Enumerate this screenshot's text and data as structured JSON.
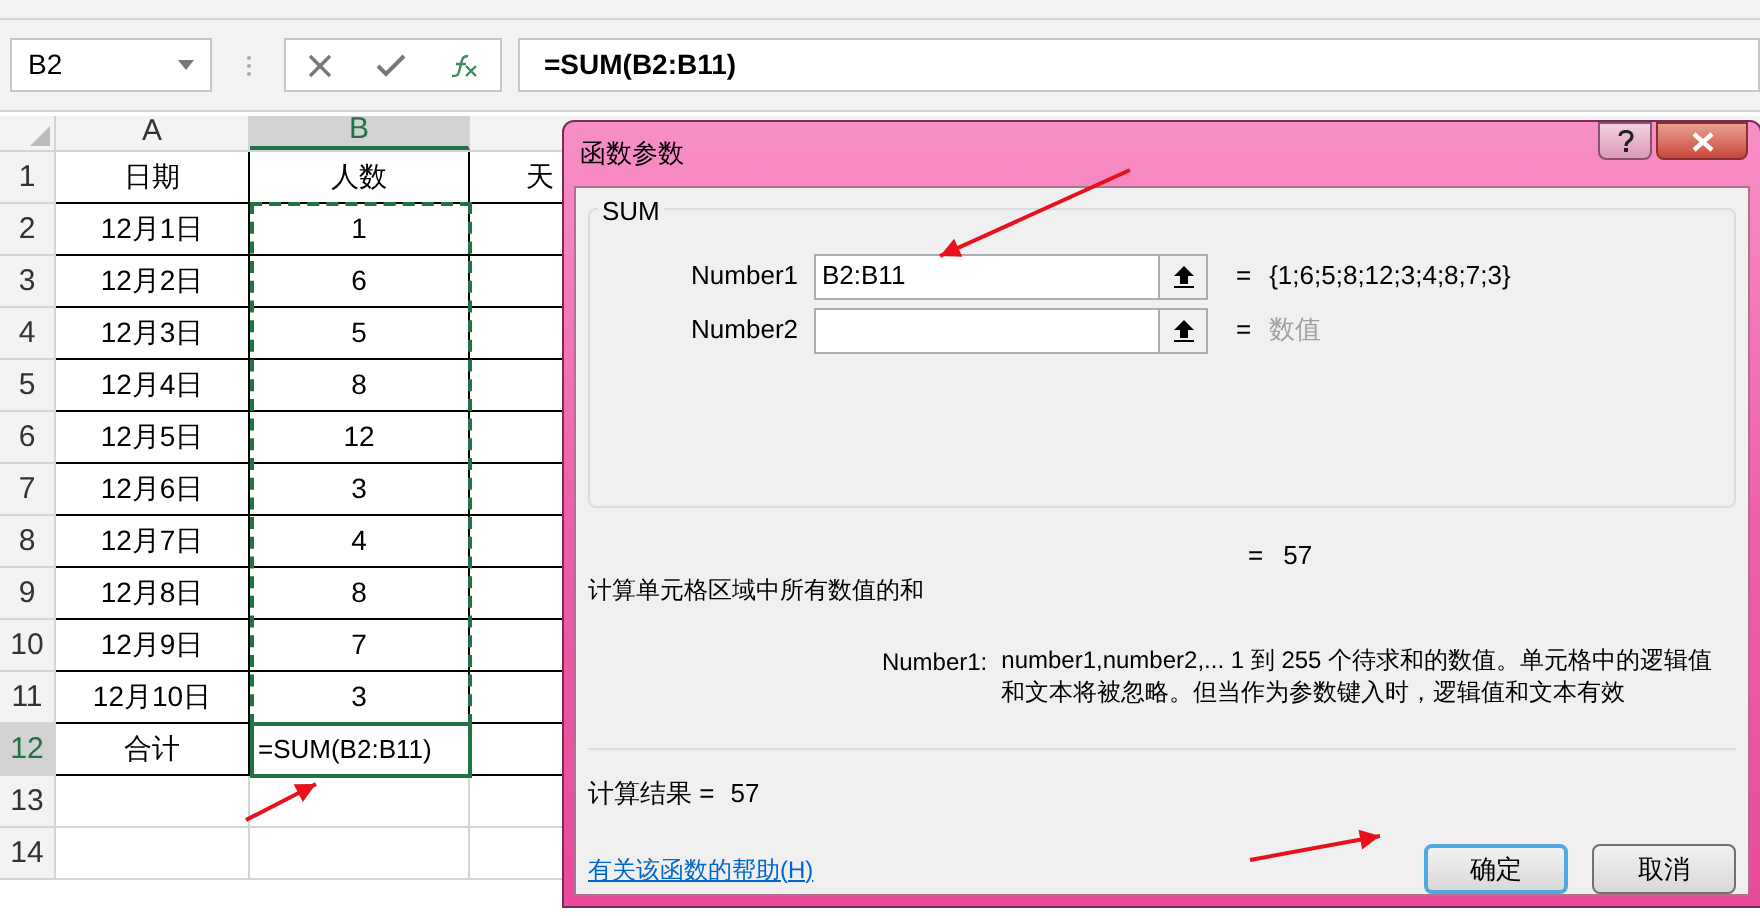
{
  "name_box": {
    "value": "B2"
  },
  "formula_bar": {
    "value": "=SUM(B2:B11)"
  },
  "columns": [
    {
      "label": "A",
      "selected": false
    },
    {
      "label": "B",
      "selected": true
    }
  ],
  "rows": [
    {
      "number": "1",
      "selected": false,
      "cells": [
        "日期",
        "人数",
        "天"
      ]
    },
    {
      "number": "2",
      "selected": false,
      "cells": [
        "12月1日",
        "1"
      ]
    },
    {
      "number": "3",
      "selected": false,
      "cells": [
        "12月2日",
        "6"
      ]
    },
    {
      "number": "4",
      "selected": false,
      "cells": [
        "12月3日",
        "5"
      ]
    },
    {
      "number": "5",
      "selected": false,
      "cells": [
        "12月4日",
        "8"
      ]
    },
    {
      "number": "6",
      "selected": false,
      "cells": [
        "12月5日",
        "12"
      ]
    },
    {
      "number": "7",
      "selected": false,
      "cells": [
        "12月6日",
        "3"
      ]
    },
    {
      "number": "8",
      "selected": false,
      "cells": [
        "12月7日",
        "4"
      ]
    },
    {
      "number": "9",
      "selected": false,
      "cells": [
        "12月8日",
        "8"
      ]
    },
    {
      "number": "10",
      "selected": false,
      "cells": [
        "12月9日",
        "7"
      ]
    },
    {
      "number": "11",
      "selected": false,
      "cells": [
        "12月10日",
        "3"
      ]
    },
    {
      "number": "12",
      "selected": true,
      "cells": [
        "合计",
        "=SUM(B2:B11)"
      ]
    },
    {
      "number": "13",
      "selected": false,
      "cells": []
    },
    {
      "number": "14",
      "selected": false,
      "cells": []
    }
  ],
  "dialog": {
    "title": "函数参数",
    "function": "SUM",
    "arguments": [
      {
        "label": "Number1",
        "value": "B2:B11",
        "equals": "=",
        "result": "{1;6;5;8;12;3;4;8;7;3}",
        "muted": false
      },
      {
        "label": "Number2",
        "equals": "=",
        "result": "数值",
        "muted": true
      }
    ],
    "formula_equals": "=",
    "formula_result": "57",
    "description": "计算单元格区域中所有数值的和",
    "argument_help": {
      "label": "Number1:",
      "text": "number1,number2,...  1 到 255 个待求和的数值。单元格中的逻辑值和文本将被忽略。但当作为参数键入时，逻辑值和文本有效"
    },
    "result_label": "计算结果 =",
    "result_value": "57",
    "help_link": "有关该函数的帮助(H)",
    "buttons": [
      {
        "label": "确定",
        "default": true
      },
      {
        "label": "取消",
        "default": false
      }
    ]
  }
}
